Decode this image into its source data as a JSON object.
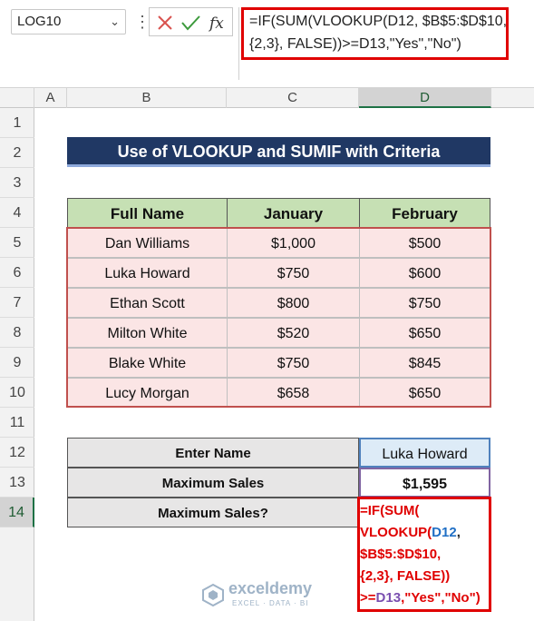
{
  "name_box": {
    "value": "LOG10"
  },
  "formula_bar": {
    "line1": "=IF(SUM(VLOOKUP(D12, $B$5:$D$10,",
    "line2": "{2,3}, FALSE))>=D13,\"Yes\",\"No\")"
  },
  "columns": [
    "A",
    "B",
    "C",
    "D"
  ],
  "rows": [
    "1",
    "2",
    "3",
    "4",
    "5",
    "6",
    "7",
    "8",
    "9",
    "10",
    "11",
    "12",
    "13",
    "14"
  ],
  "title": "Use of VLOOKUP and SUMIF with Criteria",
  "table": {
    "headers": [
      "Full Name",
      "January",
      "February"
    ],
    "rows": [
      [
        "Dan Williams",
        "$1,000",
        "$500"
      ],
      [
        "Luka Howard",
        "$750",
        "$600"
      ],
      [
        "Ethan Scott",
        "$800",
        "$750"
      ],
      [
        "Milton White",
        "$520",
        "$650"
      ],
      [
        "Blake White",
        "$750",
        "$845"
      ],
      [
        "Lucy Morgan",
        "$658",
        "$650"
      ]
    ]
  },
  "lookup": {
    "enter_name_label": "Enter Name",
    "enter_name_value": "Luka Howard",
    "max_sales_label": "Maximum Sales",
    "max_sales_value": "$1,595",
    "max_sales_q_label": "Maximum Sales?"
  },
  "cell_edit": {
    "l1": "=IF(SUM(",
    "l2a": "VLOOKUP(",
    "l2b": "D12",
    "l2c": ",",
    "l3": "$B$5:$D$10,",
    "l4": "{2,3}, FALSE))",
    "l5a": ">=",
    "l5b": "D13",
    "l5c": ",\"Yes\",\"No\")"
  },
  "watermark": {
    "name": "exceldemy",
    "tagline": "EXCEL · DATA · BI"
  },
  "colors": {
    "title_bg": "#203864",
    "header_bg": "#c6e0b4",
    "cell_bg": "#fbe5e5",
    "edit_red": "#e00000"
  }
}
